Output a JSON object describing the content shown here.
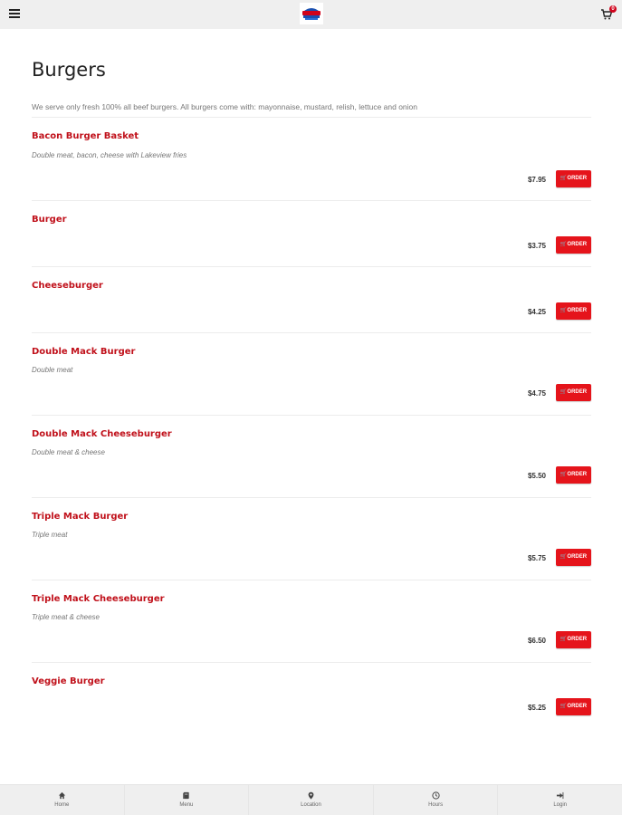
{
  "header": {
    "menu_icon": "hamburger-icon",
    "logo": "restaurant-logo",
    "cart_icon": "cart-icon",
    "cart_count": "0"
  },
  "page": {
    "title": "Burgers",
    "intro": "We serve only fresh 100% all beef burgers. All burgers come with: mayonnaise, mustard, relish, lettuce and onion"
  },
  "order_label": "ORDER",
  "items": [
    {
      "name": "Bacon Burger Basket",
      "desc": "Double meat, bacon, cheese with Lakeview fries",
      "price": "$7.95"
    },
    {
      "name": "Burger",
      "desc": "",
      "price": "$3.75"
    },
    {
      "name": "Cheeseburger",
      "desc": "",
      "price": "$4.25"
    },
    {
      "name": "Double Mack Burger",
      "desc": "Double meat",
      "price": "$4.75"
    },
    {
      "name": "Double Mack Cheeseburger",
      "desc": "Double meat & cheese",
      "price": "$5.50"
    },
    {
      "name": "Triple Mack Burger",
      "desc": "Triple meat",
      "price": "$5.75"
    },
    {
      "name": "Triple Mack Cheeseburger",
      "desc": "Triple meat & cheese",
      "price": "$6.50"
    },
    {
      "name": "Veggie Burger",
      "desc": "",
      "price": "$5.25"
    }
  ],
  "nav": [
    {
      "label": "Home",
      "icon": "home-icon"
    },
    {
      "label": "Menu",
      "icon": "menu-book-icon"
    },
    {
      "label": "Location",
      "icon": "location-pin-icon"
    },
    {
      "label": "Hours",
      "icon": "clock-icon"
    },
    {
      "label": "Login",
      "icon": "login-icon"
    }
  ],
  "colors": {
    "accent": "#c0101a",
    "button": "#e5141b",
    "bar": "#efefef"
  }
}
